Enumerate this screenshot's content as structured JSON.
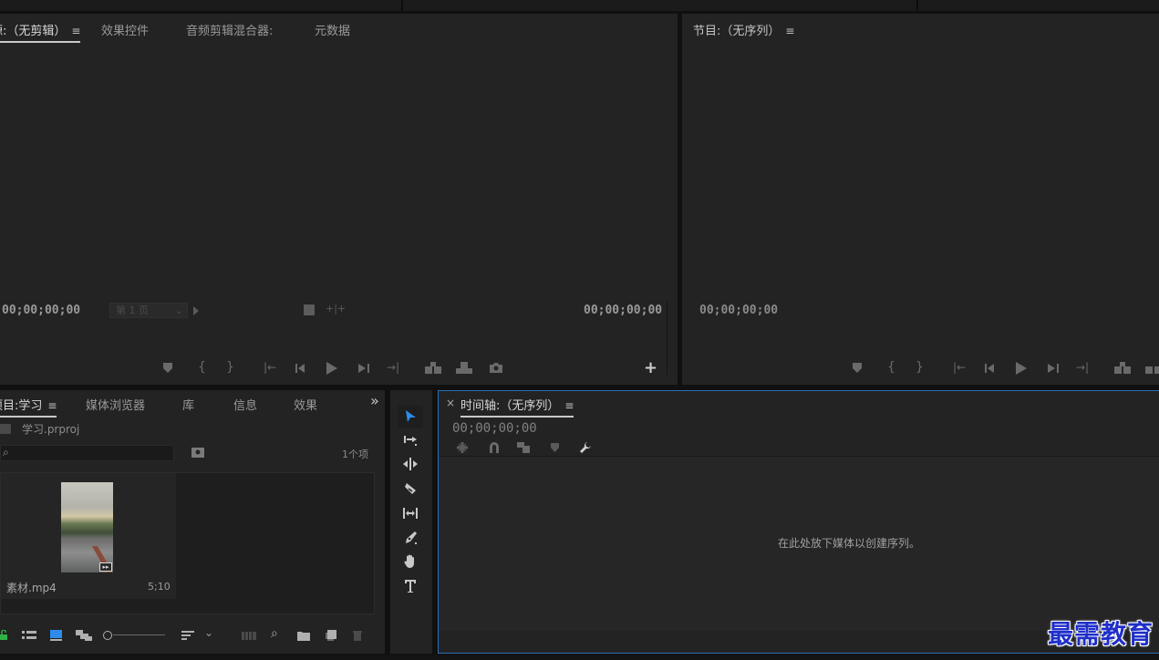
{
  "source_panel": {
    "tabs": [
      {
        "label": "源:（无剪辑）",
        "active": true
      },
      {
        "label": "效果控件"
      },
      {
        "label": "音频剪辑混合器:"
      },
      {
        "label": "元数据"
      }
    ],
    "timecode_left": "00;00;00;00",
    "page_select": "第 1 页",
    "timecode_right": "00;00;00;00"
  },
  "program_panel": {
    "title": "节目:（无序列）",
    "timecode_left": "00;00;00;00"
  },
  "project_panel": {
    "tabs": [
      {
        "label": "项目:学习",
        "active": true
      },
      {
        "label": "媒体浏览器"
      },
      {
        "label": "库"
      },
      {
        "label": "信息"
      },
      {
        "label": "效果"
      }
    ],
    "overflow": "»",
    "project_file": "学习.prproj",
    "search_placeholder": "",
    "item_count": "1个项",
    "clip": {
      "name": "素材.mp4",
      "duration": "5;10"
    }
  },
  "timeline_panel": {
    "close": "×",
    "title": "时间轴:（无序列）",
    "timecode": "00;00;00;00",
    "empty_message": "在此处放下媒体以创建序列。"
  },
  "tools": [
    "selection-tool",
    "track-select-tool",
    "ripple-edit-tool",
    "razor-tool",
    "slip-tool",
    "pen-tool",
    "hand-tool",
    "type-tool"
  ],
  "watermark": "最需教育",
  "colors": {
    "accent": "#2d8ceb",
    "panel": "#232323",
    "gap": "#101010"
  }
}
